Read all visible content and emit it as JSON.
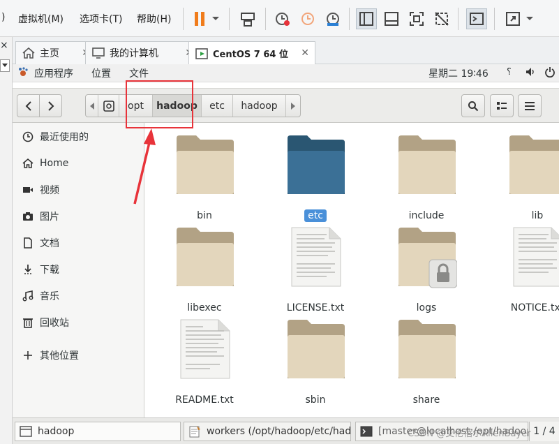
{
  "vm_menu": {
    "items": [
      ")",
      "虚拟机(M)",
      "选项卡(T)",
      "帮助(H)"
    ]
  },
  "vm_tabs": [
    {
      "label": "主页"
    },
    {
      "label": "我的计算机"
    },
    {
      "label": "CentOS 7 64 位"
    }
  ],
  "gnome": {
    "apps": "应用程序",
    "places": "位置",
    "files": "文件",
    "clock": "星期二 19∶46"
  },
  "breadcrumbs": [
    "opt",
    "hadoop",
    "etc",
    "hadoop"
  ],
  "breadcrumb_selected_index": 1,
  "sidebar": {
    "items": [
      {
        "label": "最近使用的",
        "icon": "clock-icon"
      },
      {
        "label": "Home",
        "icon": "home-icon"
      },
      {
        "label": "视频",
        "icon": "video-icon"
      },
      {
        "label": "图片",
        "icon": "camera-icon"
      },
      {
        "label": "文档",
        "icon": "document-icon"
      },
      {
        "label": "下载",
        "icon": "download-icon"
      },
      {
        "label": "音乐",
        "icon": "music-icon"
      },
      {
        "label": "回收站",
        "icon": "trash-icon"
      },
      {
        "label": "其他位置",
        "icon": "plus-icon"
      }
    ]
  },
  "files": [
    {
      "name": "bin",
      "type": "folder"
    },
    {
      "name": "etc",
      "type": "folder",
      "selected": true
    },
    {
      "name": "include",
      "type": "folder"
    },
    {
      "name": "lib",
      "type": "folder"
    },
    {
      "name": "libexec",
      "type": "folder"
    },
    {
      "name": "LICENSE.txt",
      "type": "text"
    },
    {
      "name": "logs",
      "type": "folder-locked"
    },
    {
      "name": "NOTICE.txt",
      "type": "text"
    },
    {
      "name": "README.txt",
      "type": "text"
    },
    {
      "name": "sbin",
      "type": "folder"
    },
    {
      "name": "share",
      "type": "folder"
    }
  ],
  "taskbar": {
    "items": [
      {
        "label": "hadoop"
      },
      {
        "label": "workers (/opt/hadoop/etc/hado…"
      },
      {
        "label": "[master@localhost:/opt/hadoop]"
      }
    ],
    "pager": "1 / 4",
    "watermark": "CSDN @艾伦蓓尔AllenBayer"
  },
  "colors": {
    "selected_folder": "#3b7096",
    "folder": "#d8c5a1",
    "annotation": "#e8333a",
    "selection": "#4a90d9"
  }
}
